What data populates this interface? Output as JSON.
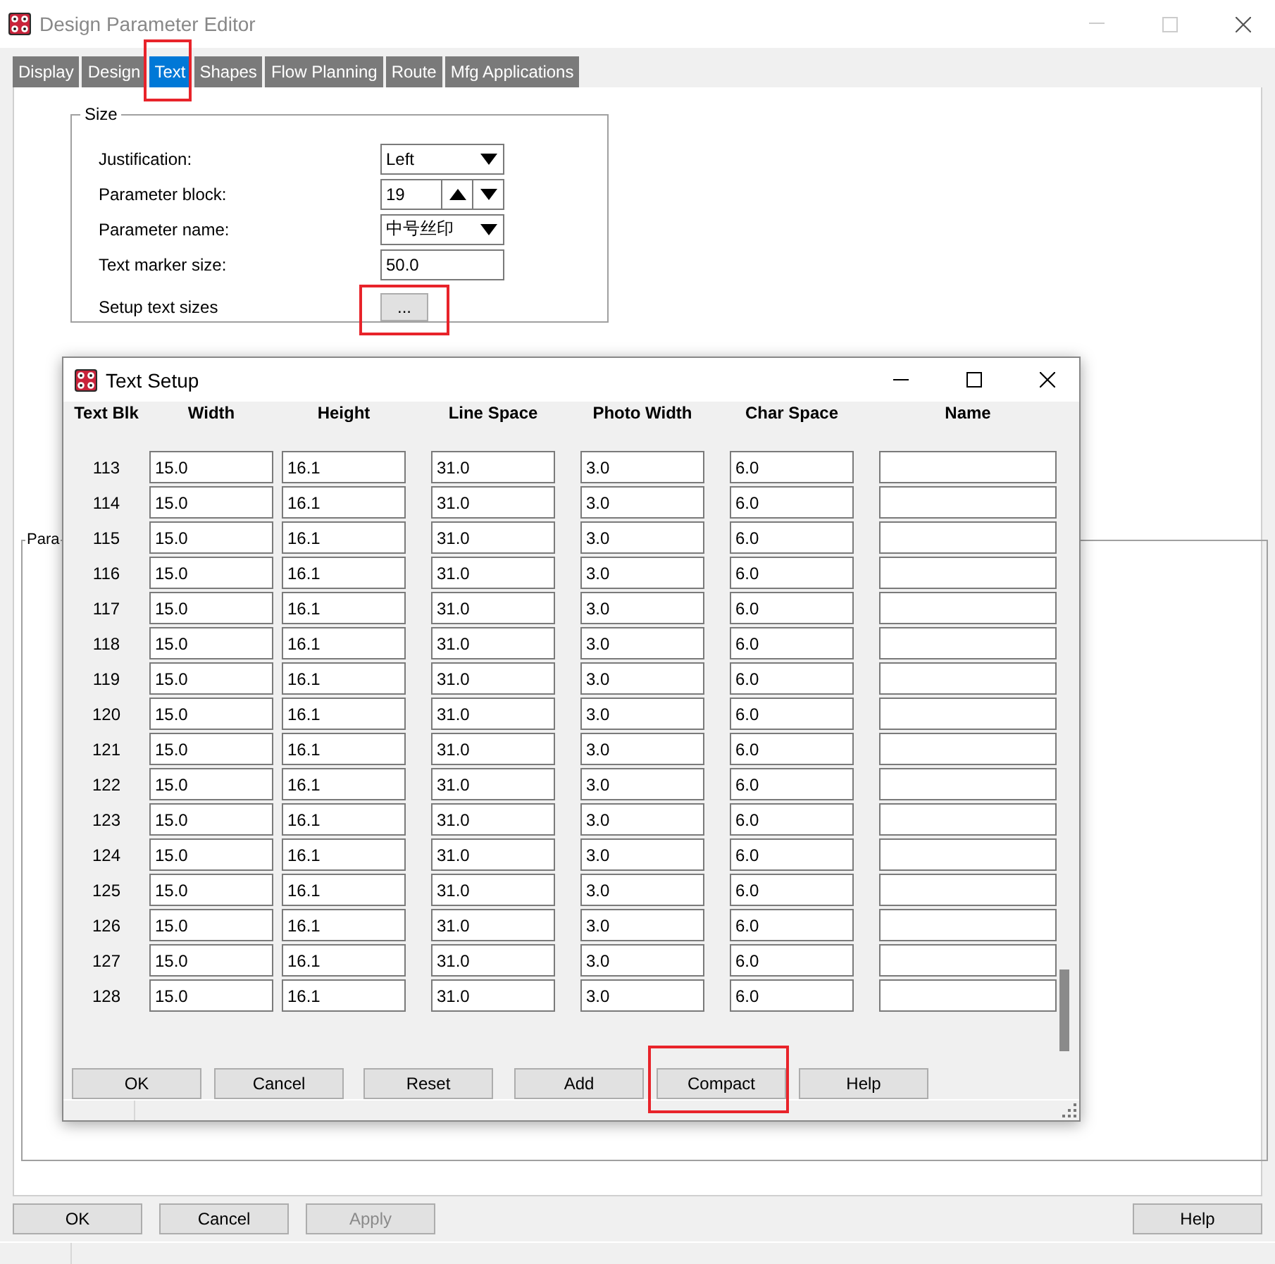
{
  "window": {
    "title": "Design Parameter Editor"
  },
  "tabs": [
    {
      "label": "Display",
      "selected": false,
      "highlighted": false
    },
    {
      "label": "Design",
      "selected": false,
      "highlighted": false
    },
    {
      "label": "Text",
      "selected": true,
      "highlighted": true
    },
    {
      "label": "Shapes",
      "selected": false,
      "highlighted": false
    },
    {
      "label": "Flow Planning",
      "selected": false,
      "highlighted": false
    },
    {
      "label": "Route",
      "selected": false,
      "highlighted": false
    },
    {
      "label": "Mfg Applications",
      "selected": false,
      "highlighted": false
    }
  ],
  "size_group": {
    "title": "Size",
    "fields": [
      {
        "kind": "dropdown",
        "label": "Justification:",
        "value": "Left"
      },
      {
        "kind": "spinner",
        "label": "Parameter block:",
        "value": "19"
      },
      {
        "kind": "dropdown",
        "label": "Parameter name:",
        "value": "中号丝印"
      },
      {
        "kind": "text",
        "label": "Text marker size:",
        "value": "50.0"
      },
      {
        "kind": "button",
        "label": "Setup text sizes",
        "button_label": "...",
        "highlighted": true
      }
    ]
  },
  "parameters_group": {
    "title": "Para"
  },
  "buttons": [
    {
      "label": "OK",
      "disabled": false
    },
    {
      "label": "Cancel",
      "disabled": false
    },
    {
      "label": "Apply",
      "disabled": true
    },
    {
      "label": "Help",
      "disabled": false
    }
  ],
  "dialog": {
    "title": "Text Setup",
    "columns": [
      "Text Blk",
      "Width",
      "Height",
      "Line Space",
      "Photo Width",
      "Char Space",
      "Name"
    ],
    "rows": [
      {
        "block": "113",
        "values": [
          "15.0",
          "16.1",
          "31.0",
          "3.0",
          "6.0"
        ]
      },
      {
        "block": "114",
        "values": [
          "15.0",
          "16.1",
          "31.0",
          "3.0",
          "6.0"
        ]
      },
      {
        "block": "115",
        "values": [
          "15.0",
          "16.1",
          "31.0",
          "3.0",
          "6.0"
        ]
      },
      {
        "block": "116",
        "values": [
          "15.0",
          "16.1",
          "31.0",
          "3.0",
          "6.0"
        ]
      },
      {
        "block": "117",
        "values": [
          "15.0",
          "16.1",
          "31.0",
          "3.0",
          "6.0"
        ]
      },
      {
        "block": "118",
        "values": [
          "15.0",
          "16.1",
          "31.0",
          "3.0",
          "6.0"
        ]
      },
      {
        "block": "119",
        "values": [
          "15.0",
          "16.1",
          "31.0",
          "3.0",
          "6.0"
        ]
      },
      {
        "block": "120",
        "values": [
          "15.0",
          "16.1",
          "31.0",
          "3.0",
          "6.0"
        ]
      },
      {
        "block": "121",
        "values": [
          "15.0",
          "16.1",
          "31.0",
          "3.0",
          "6.0"
        ]
      },
      {
        "block": "122",
        "values": [
          "15.0",
          "16.1",
          "31.0",
          "3.0",
          "6.0"
        ]
      },
      {
        "block": "123",
        "values": [
          "15.0",
          "16.1",
          "31.0",
          "3.0",
          "6.0"
        ]
      },
      {
        "block": "124",
        "values": [
          "15.0",
          "16.1",
          "31.0",
          "3.0",
          "6.0"
        ]
      },
      {
        "block": "125",
        "values": [
          "15.0",
          "16.1",
          "31.0",
          "3.0",
          "6.0"
        ]
      },
      {
        "block": "126",
        "values": [
          "15.0",
          "16.1",
          "31.0",
          "3.0",
          "6.0"
        ]
      },
      {
        "block": "127",
        "values": [
          "15.0",
          "16.1",
          "31.0",
          "3.0",
          "6.0"
        ]
      },
      {
        "block": "128",
        "values": [
          "15.0",
          "16.1",
          "31.0",
          "3.0",
          "6.0"
        ]
      }
    ],
    "buttons": [
      {
        "label": "OK",
        "highlighted": false
      },
      {
        "label": "Cancel",
        "highlighted": false
      },
      {
        "label": "Reset",
        "highlighted": false
      },
      {
        "label": "Add",
        "highlighted": false
      },
      {
        "label": "Compact",
        "highlighted": true
      },
      {
        "label": "Help",
        "highlighted": false
      }
    ]
  }
}
